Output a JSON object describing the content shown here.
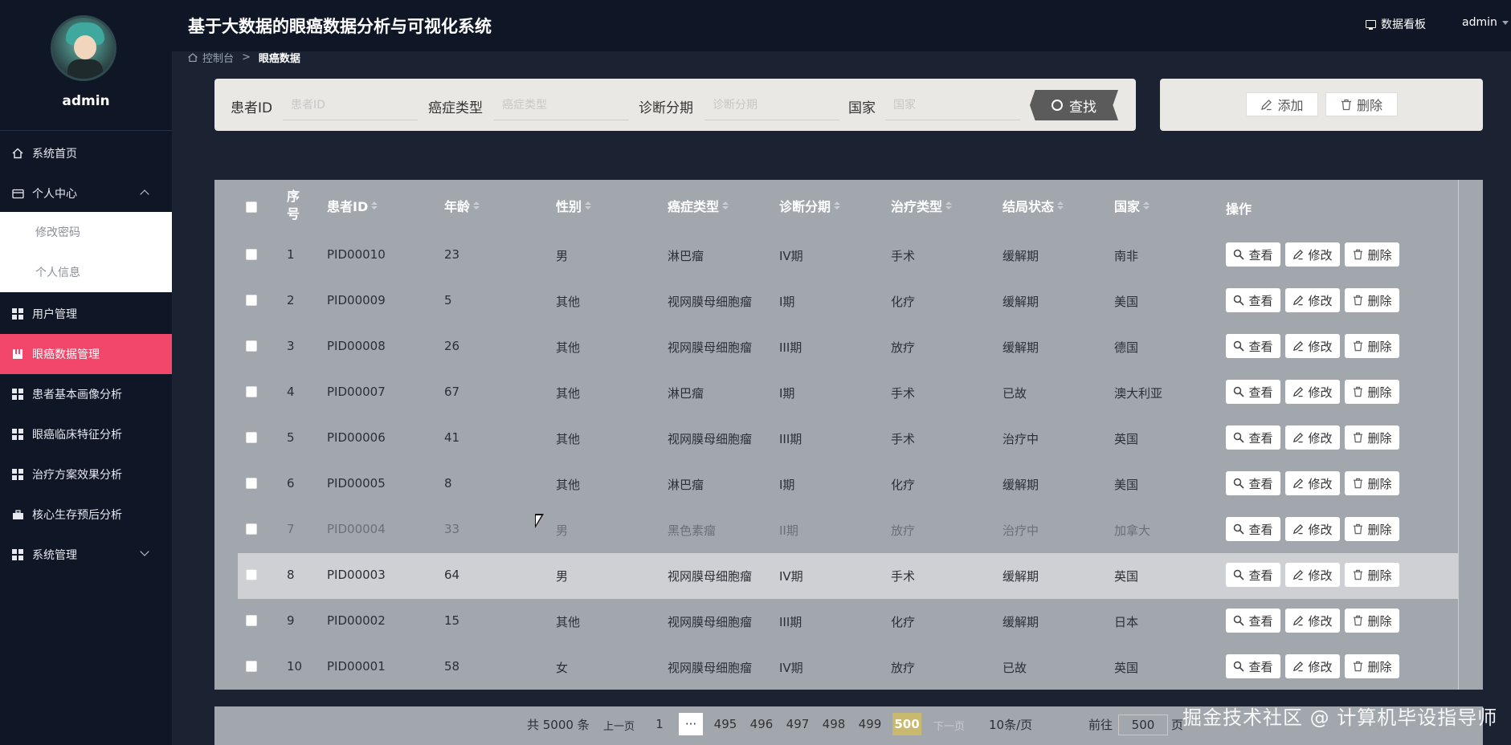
{
  "app": {
    "title": "基于大数据的眼癌数据分析与可视化系统",
    "user": "admin",
    "dashboard_link": "数据看板"
  },
  "sidebar": {
    "username": "admin",
    "items": [
      {
        "label": "系统首页"
      },
      {
        "label": "个人中心"
      },
      {
        "label": "用户管理"
      },
      {
        "label": "眼癌数据管理"
      },
      {
        "label": "患者基本画像分析"
      },
      {
        "label": "眼癌临床特征分析"
      },
      {
        "label": "治疗方案效果分析"
      },
      {
        "label": "核心生存预后分析"
      },
      {
        "label": "系统管理"
      }
    ],
    "sub_items": [
      {
        "label": "修改密码"
      },
      {
        "label": "个人信息"
      }
    ]
  },
  "breadcrumb": {
    "home": "控制台",
    "sep": ">",
    "current": "眼癌数据"
  },
  "search": {
    "fields": [
      {
        "label": "患者ID",
        "placeholder": "患者ID"
      },
      {
        "label": "癌症类型",
        "placeholder": "癌症类型"
      },
      {
        "label": "诊断分期",
        "placeholder": "诊断分期"
      },
      {
        "label": "国家",
        "placeholder": "国家"
      }
    ],
    "button": "查找"
  },
  "actions": {
    "add": "添加",
    "delete": "删除"
  },
  "table": {
    "headers": {
      "index_line1": "序",
      "index_line2": "号",
      "patient_id": "患者ID",
      "age": "年龄",
      "gender": "性别",
      "cancer_type": "癌症类型",
      "stage": "诊断分期",
      "treatment": "治疗类型",
      "outcome": "结局状态",
      "country": "国家",
      "ops": "操作"
    },
    "rows": [
      {
        "idx": "1",
        "pid": "PID00010",
        "age": "23",
        "gender": "男",
        "type": "淋巴瘤",
        "stage": "IV期",
        "treatment": "手术",
        "outcome": "缓解期",
        "country": "南非"
      },
      {
        "idx": "2",
        "pid": "PID00009",
        "age": "5",
        "gender": "其他",
        "type": "视网膜母细胞瘤",
        "stage": "I期",
        "treatment": "化疗",
        "outcome": "缓解期",
        "country": "美国"
      },
      {
        "idx": "3",
        "pid": "PID00008",
        "age": "26",
        "gender": "其他",
        "type": "视网膜母细胞瘤",
        "stage": "III期",
        "treatment": "放疗",
        "outcome": "缓解期",
        "country": "德国"
      },
      {
        "idx": "4",
        "pid": "PID00007",
        "age": "67",
        "gender": "其他",
        "type": "淋巴瘤",
        "stage": "I期",
        "treatment": "手术",
        "outcome": "已故",
        "country": "澳大利亚"
      },
      {
        "idx": "5",
        "pid": "PID00006",
        "age": "41",
        "gender": "其他",
        "type": "视网膜母细胞瘤",
        "stage": "III期",
        "treatment": "手术",
        "outcome": "治疗中",
        "country": "英国"
      },
      {
        "idx": "6",
        "pid": "PID00005",
        "age": "8",
        "gender": "其他",
        "type": "淋巴瘤",
        "stage": "I期",
        "treatment": "化疗",
        "outcome": "缓解期",
        "country": "美国"
      },
      {
        "idx": "7",
        "pid": "PID00004",
        "age": "33",
        "gender": "男",
        "type": "黑色素瘤",
        "stage": "II期",
        "treatment": "放疗",
        "outcome": "治疗中",
        "country": "加拿大"
      },
      {
        "idx": "8",
        "pid": "PID00003",
        "age": "64",
        "gender": "男",
        "type": "视网膜母细胞瘤",
        "stage": "IV期",
        "treatment": "手术",
        "outcome": "缓解期",
        "country": "英国"
      },
      {
        "idx": "9",
        "pid": "PID00002",
        "age": "15",
        "gender": "其他",
        "type": "视网膜母细胞瘤",
        "stage": "III期",
        "treatment": "化疗",
        "outcome": "缓解期",
        "country": "日本"
      },
      {
        "idx": "10",
        "pid": "PID00001",
        "age": "58",
        "gender": "女",
        "type": "视网膜母细胞瘤",
        "stage": "IV期",
        "treatment": "放疗",
        "outcome": "已故",
        "country": "英国"
      }
    ],
    "row_actions": {
      "view": "查看",
      "edit": "修改",
      "delete": "删除"
    }
  },
  "pagination": {
    "total": "共 5000 条",
    "prev": "上一页",
    "first": "1",
    "ellipsis": "···",
    "pages": [
      "495",
      "496",
      "497",
      "498",
      "499"
    ],
    "current": "500",
    "next": "下一页",
    "page_size": "10条/页",
    "goto_label": "前往",
    "goto_value": "500",
    "goto_unit": "页"
  },
  "watermark": "掘金技术社区 @ 计算机毕设指导师",
  "colors": {
    "sidebar_bg": "#0f1726",
    "active_menu": "#f2476a",
    "content_bg": "#1b2333",
    "current_page": "#c8b96e"
  }
}
